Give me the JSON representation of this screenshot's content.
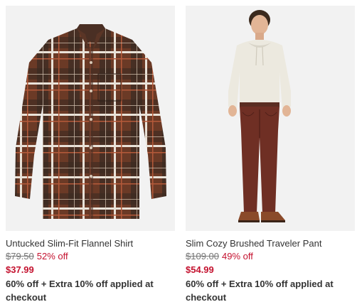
{
  "products": [
    {
      "image_label": "flannel-shirt-image",
      "name": "Untucked Slim-Fit Flannel Shirt",
      "original_price": "$79.50",
      "percent_off": "52% off",
      "sale_price": "$37.99",
      "promo": "60% off + Extra 10% off applied at checkout"
    },
    {
      "image_label": "traveler-pant-image",
      "name": "Slim Cozy Brushed Traveler Pant",
      "original_price": "$109.00",
      "percent_off": "49% off",
      "sale_price": "$54.99",
      "promo": "60% off + Extra 10% off applied at checkout"
    }
  ],
  "colors": {
    "sale_red": "#c4122f",
    "image_background": "#f2f2f2",
    "text": "#333333"
  }
}
